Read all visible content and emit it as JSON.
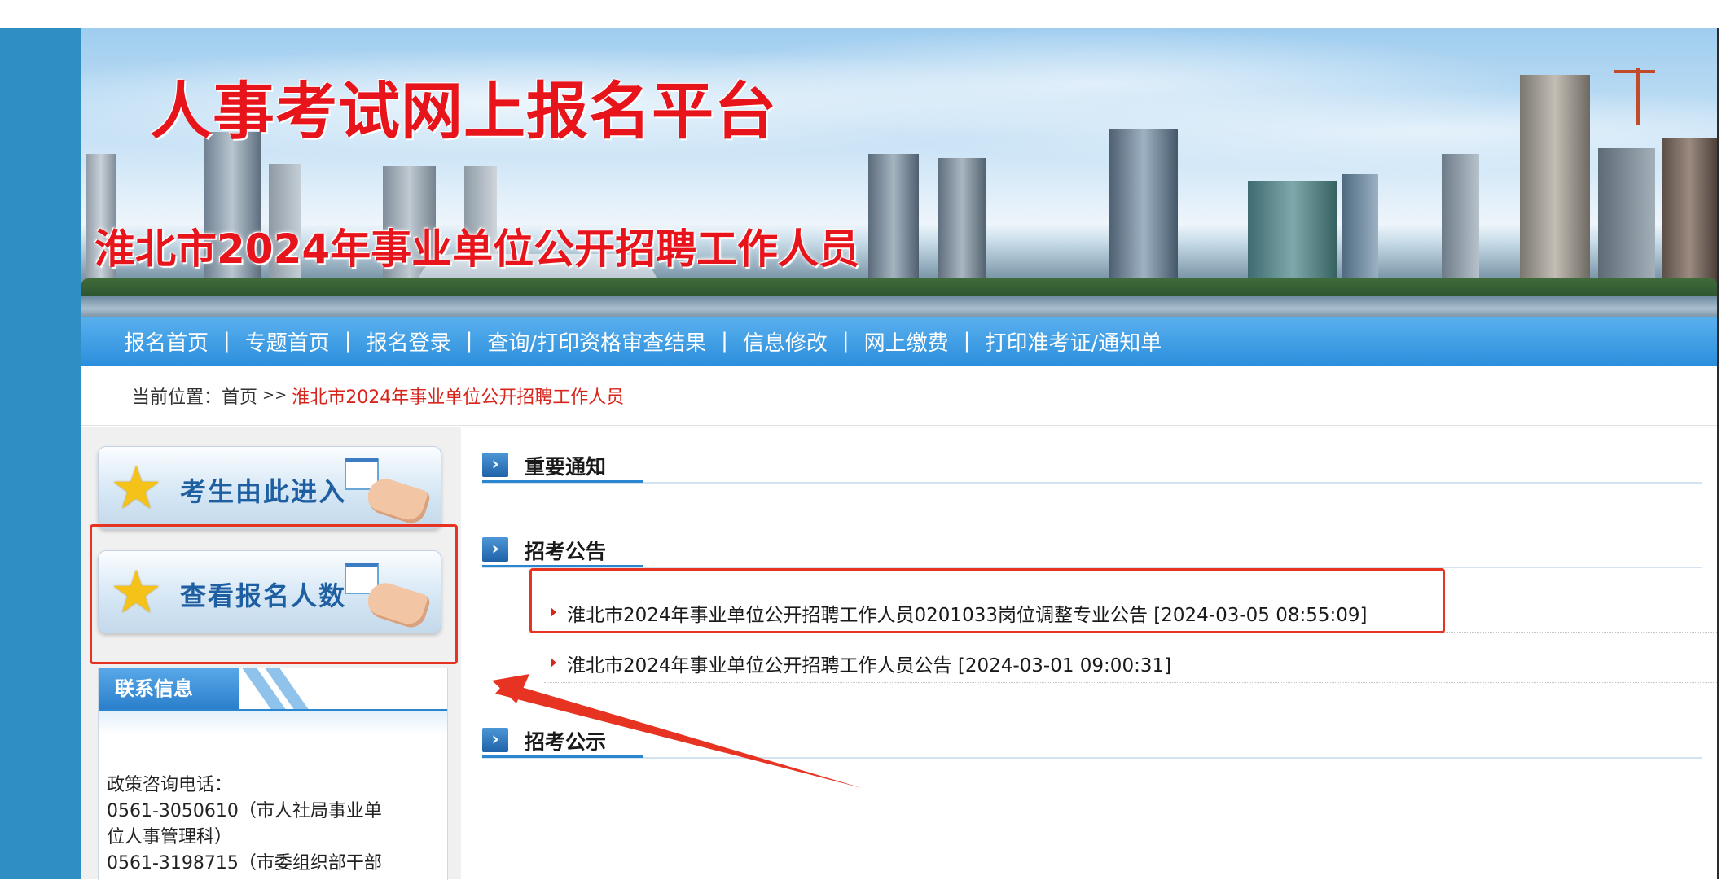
{
  "banner": {
    "title": "人事考试网上报名平台",
    "subtitle": "淮北市2024年事业单位公开招聘工作人员"
  },
  "nav": {
    "items": [
      {
        "label": "报名首页"
      },
      {
        "label": "专题首页"
      },
      {
        "label": "报名登录"
      },
      {
        "label": "查询/打印资格审查结果"
      },
      {
        "label": "信息修改"
      },
      {
        "label": "网上缴费"
      },
      {
        "label": "打印准考证/通知单"
      }
    ],
    "separator": "|"
  },
  "breadcrumb": {
    "prefix": "当前位置：",
    "home": "首页",
    "arrow": ">>",
    "current": "淮北市2024年事业单位公开招聘工作人员"
  },
  "sidebar": {
    "enter_button": "考生由此进入",
    "count_button": "查看报名人数",
    "contact": {
      "title": "联系信息",
      "lines": [
        "政策咨询电话：",
        "0561-3050610（市人社局事业单",
        "位人事管理科）",
        "0561-3198715（市委组织部干部"
      ]
    }
  },
  "sections": [
    {
      "title": "重要通知",
      "icon": "chevron-right-icon"
    },
    {
      "title": "招考公告",
      "icon": "chevron-right-icon"
    },
    {
      "title": "招考公示",
      "icon": "chevron-right-icon"
    }
  ],
  "announcements": [
    {
      "text": "淮北市2024年事业单位公开招聘工作人员0201033岗位调整专业公告 [2024-03-05 08:55:09]"
    },
    {
      "text": "淮北市2024年事业单位公开招聘工作人员公告 [2024-03-01 09:00:31]"
    }
  ],
  "colors": {
    "brand_blue": "#2c8fdc",
    "title_red": "#e8141b",
    "highlight_red": "#e63322",
    "side_strip": "#2f8ec4"
  }
}
